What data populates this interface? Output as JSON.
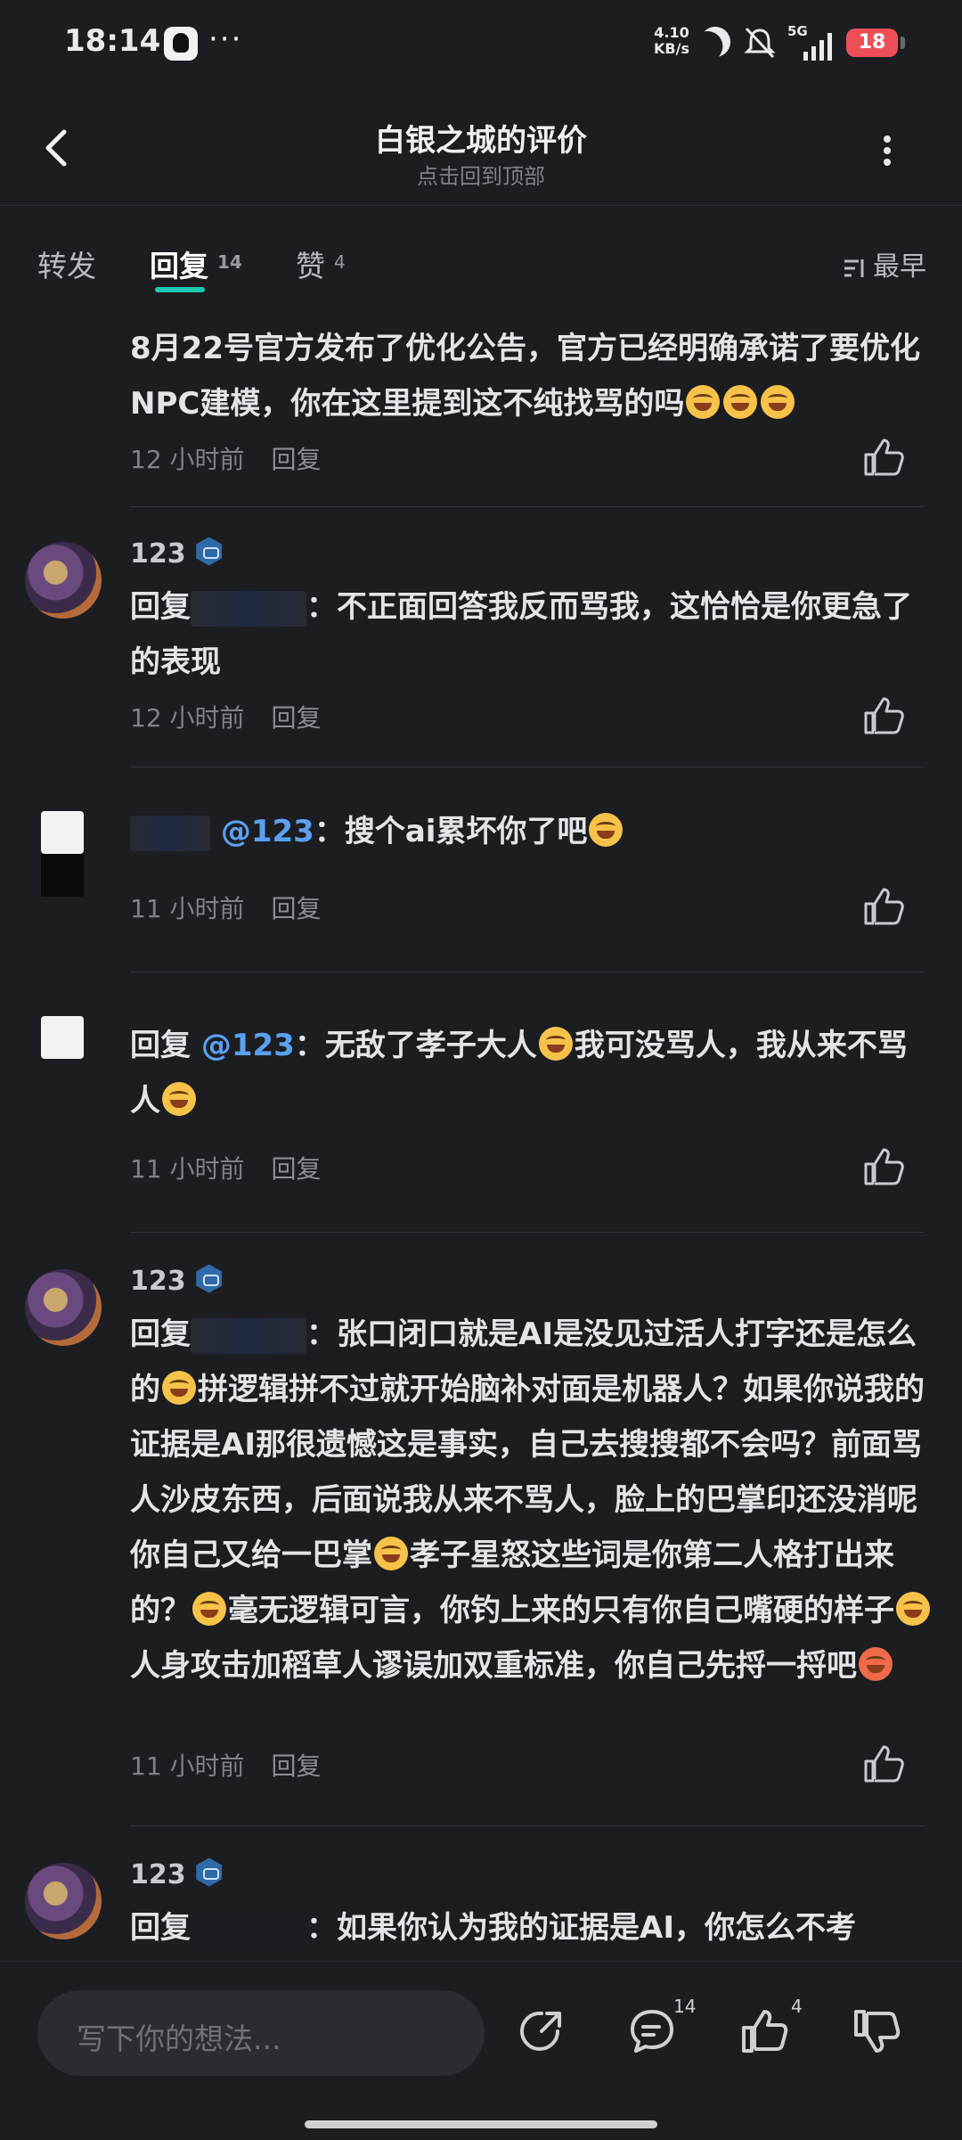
{
  "status_bar": {
    "time": "18:14",
    "dots": "···",
    "speed_top": "4.10",
    "speed_bottom": "KB/s",
    "network": "5G",
    "battery": "18"
  },
  "header": {
    "title": "白银之城的评价",
    "subtitle": "点击回到顶部"
  },
  "tabs": {
    "repost": "转发",
    "reply": "回复",
    "reply_count": "14",
    "like": "赞",
    "like_count": "4",
    "sort": "最早"
  },
  "comments": [
    {
      "text": "8月22号官方发布了优化公告，官方已经明确承诺了要优化NPC建模，你在这里提到这不纯找骂的吗",
      "time": "12 小时前",
      "reply": "回复"
    },
    {
      "name": "123",
      "reply_prefix": "回复",
      "text": "：不正面回答我反而骂我，这恰恰是你更急了的表现",
      "time": "12 小时前",
      "reply": "回复"
    },
    {
      "mention": "@123",
      "text": "：搜个ai累坏你了吧",
      "time": "11 小时前",
      "reply": "回复"
    },
    {
      "reply_prefix": "回复",
      "mention": "@123",
      "text": "：无敌了孝子大人",
      "text2": "我可没骂人，我从来不骂人",
      "time": "11 小时前",
      "reply": "回复"
    },
    {
      "name": "123",
      "reply_prefix": "回复",
      "text": "：张口闭口就是AI是没见过活人打字还是怎么的",
      "text2": "拼逻辑拼不过就开始脑补对面是机器人？如果你说我的证据是AI那很遗憾这是事实，自己去搜搜都不会吗？前面骂人沙皮东西，后面说我从来不骂人，脸上的巴掌印还没消呢你自己又给一巴掌",
      "text3": "孝子星怒这些词是你第二人格打出来的？",
      "text4": "毫无逻辑可言，你钓上来的只有你自己嘴硬的样子",
      "text5": "人身攻击加稻草人谬误加双重标准，你自己先捋一捋吧",
      "time": "11 小时前",
      "reply": "回复"
    },
    {
      "name": "123",
      "reply_prefix": "回复",
      "text": "：如果你认为我的证据是AI，你怎么不考"
    }
  ],
  "bottom_bar": {
    "placeholder": "写下你的想法...",
    "comment_count": "14",
    "like_count": "4"
  }
}
